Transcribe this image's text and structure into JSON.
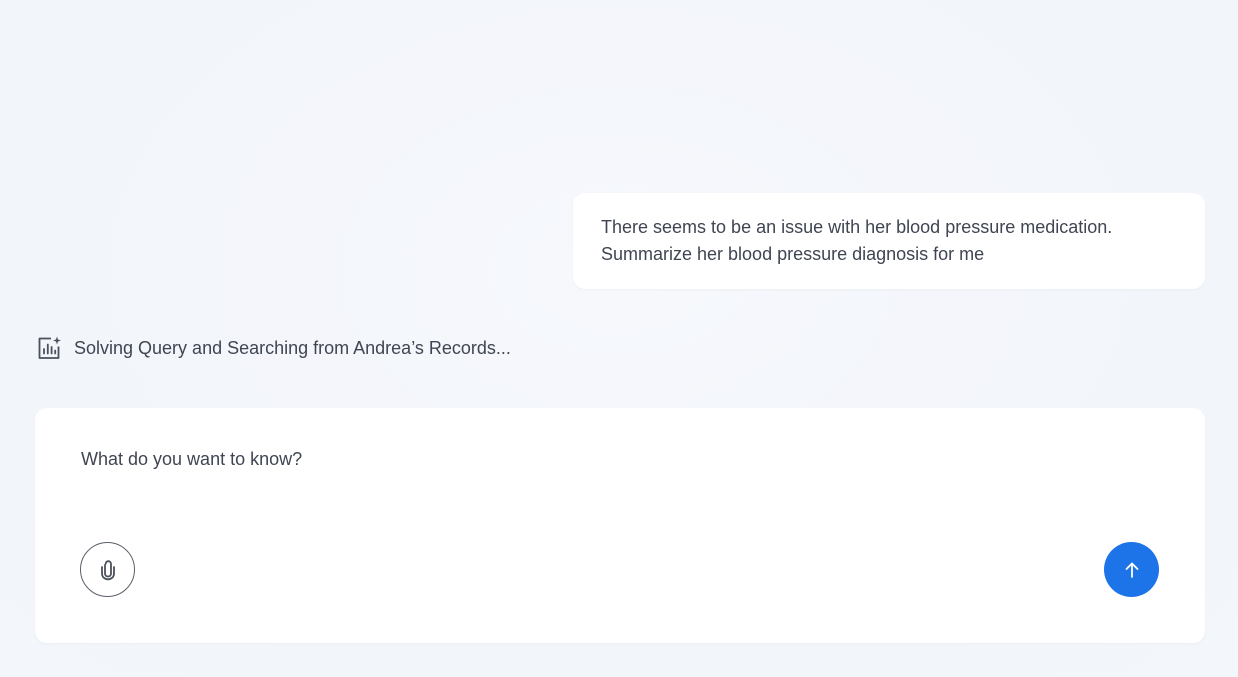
{
  "conversation": {
    "user_message_line1": "There seems to be an issue with her blood pressure medication.",
    "user_message_line2": "Summarize her blood pressure diagnosis for me"
  },
  "status": {
    "icon": "chart-sparkle-icon",
    "text": "Solving Query and Searching from Andrea’s Records..."
  },
  "composer": {
    "placeholder": "What do you want to know?",
    "attach_icon": "paperclip-icon",
    "send_icon": "arrow-up-icon"
  },
  "colors": {
    "send_button": "#1c74e8",
    "background": "#f4f7fb",
    "text": "#3f4552"
  }
}
